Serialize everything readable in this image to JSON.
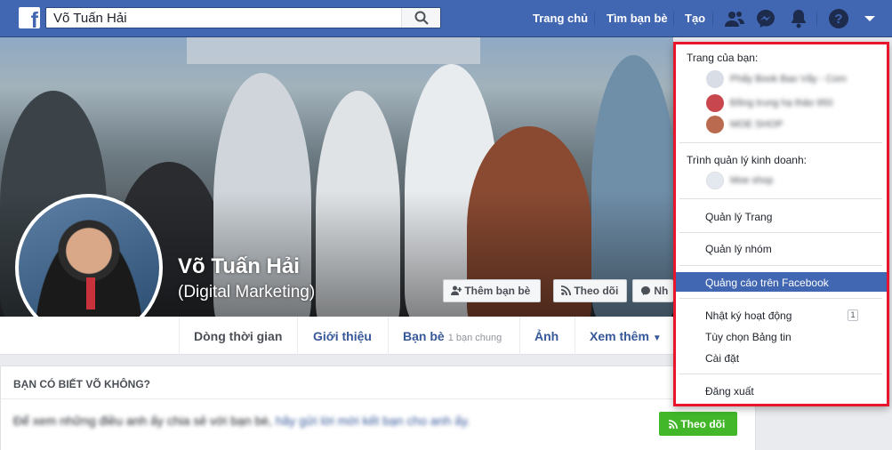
{
  "search": {
    "value": "Võ Tuấn Hải"
  },
  "nav": {
    "home": "Trang chủ",
    "find_friends": "Tìm bạn bè",
    "create": "Tạo"
  },
  "profile": {
    "name": "Võ Tuấn Hải",
    "alternate_name": "(Digital Marketing)",
    "add_friend": "Thêm bạn bè",
    "follow": "Theo dõi",
    "message": "Nh"
  },
  "tabs": {
    "timeline": "Dòng thời gian",
    "about": "Giới thiệu",
    "friends": "Bạn bè",
    "mutual": "1 bạn chung",
    "photos": "Ảnh",
    "more": "Xem thêm"
  },
  "card": {
    "title": "BẠN CÓ BIẾT VÕ KHÔNG?",
    "text": "Để xem những điều anh ấy chia sẻ với bạn bè,",
    "link": "hãy gửi lời mời kết bạn cho anh ấy.",
    "follow": "Theo dõi"
  },
  "dropdown": {
    "your_pages_header": "Trang của bạn:",
    "pages": [
      {
        "name": "Phấy Book Bao Vấy - Com",
        "color": "#d8dde6"
      },
      {
        "name": "Đồng trung hạ thảo 950",
        "color": "#c8474f"
      },
      {
        "name": "MOE SHOP",
        "color": "#b96a4f"
      }
    ],
    "business_header": "Trình quản lý kinh doanh:",
    "business_pages": [
      {
        "name": "Moe shop",
        "color": "#e4e8ef"
      }
    ],
    "manage_pages": "Quản lý Trang",
    "manage_groups": "Quản lý nhóm",
    "advertise": "Quảng cáo trên Facebook",
    "activity_log": "Nhật ký hoạt động",
    "activity_count": "1",
    "news_feed_prefs": "Tùy chọn Bảng tin",
    "settings": "Cài đặt",
    "logout": "Đăng xuất"
  },
  "colors": {
    "brand_blue": "#4267b2",
    "highlight_red": "#e8152c",
    "follow_green": "#42b72a"
  }
}
